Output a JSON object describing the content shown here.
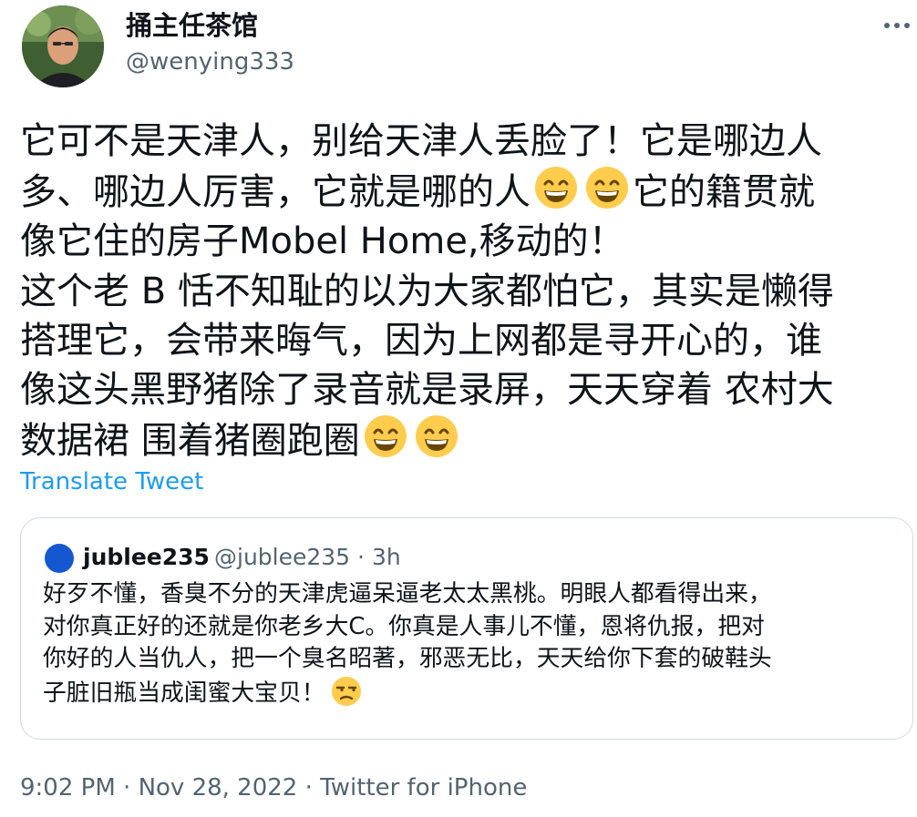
{
  "author": {
    "display_name": "捅主任茶馆",
    "handle": "@wenying333"
  },
  "more_icon": "more-horizontal-icon",
  "tweet": {
    "lines": [
      "它可不是天津人，别给天津人丢脸了！它是哪边人",
      "多、哪边人厉害，它就是哪的人",
      "它的籍贯就",
      "像它住的房子Mobel Home,移动的！",
      "这个老 B 恬不知耻的以为大家都怕它，其实是懒得",
      "搭理它，会带来晦气，因为上网都是寻开心的，谁",
      "像这头黑野猪除了录音就是录屏，天天穿着 农村大",
      "数据裙 围着猪圈跑圈"
    ],
    "emoji_name": "grinning-face-with-smiling-eyes"
  },
  "translate_label": "Translate Tweet",
  "quoted_tweet": {
    "display_name": "jublee235",
    "handle": "@jublee235",
    "separator": "·",
    "time": "3h",
    "lines": [
      "好歹不懂，香臭不分的天津虎逼呆逼老太太黑桃。明眼人都看得出来，",
      "对你真正好的还就是你老乡大C。你真是人事儿不懂，恩将仇报，把对",
      "你好的人当仇人，把一个臭名昭著，邪恶无比，天天给你下套的破鞋头",
      "子脏旧瓶当成闺蜜大宝贝！"
    ],
    "emoji_name": "unamused-face"
  },
  "footer": {
    "time": "9:02 PM",
    "sep1": " · ",
    "date": "Nov 28, 2022",
    "sep2": " · ",
    "source": "Twitter for iPhone"
  },
  "colors": {
    "text": "#0f1419",
    "secondary": "#536471",
    "link": "#1d9bf0",
    "border": "#cfd9de",
    "emoji_face": "#ffcc4d"
  }
}
